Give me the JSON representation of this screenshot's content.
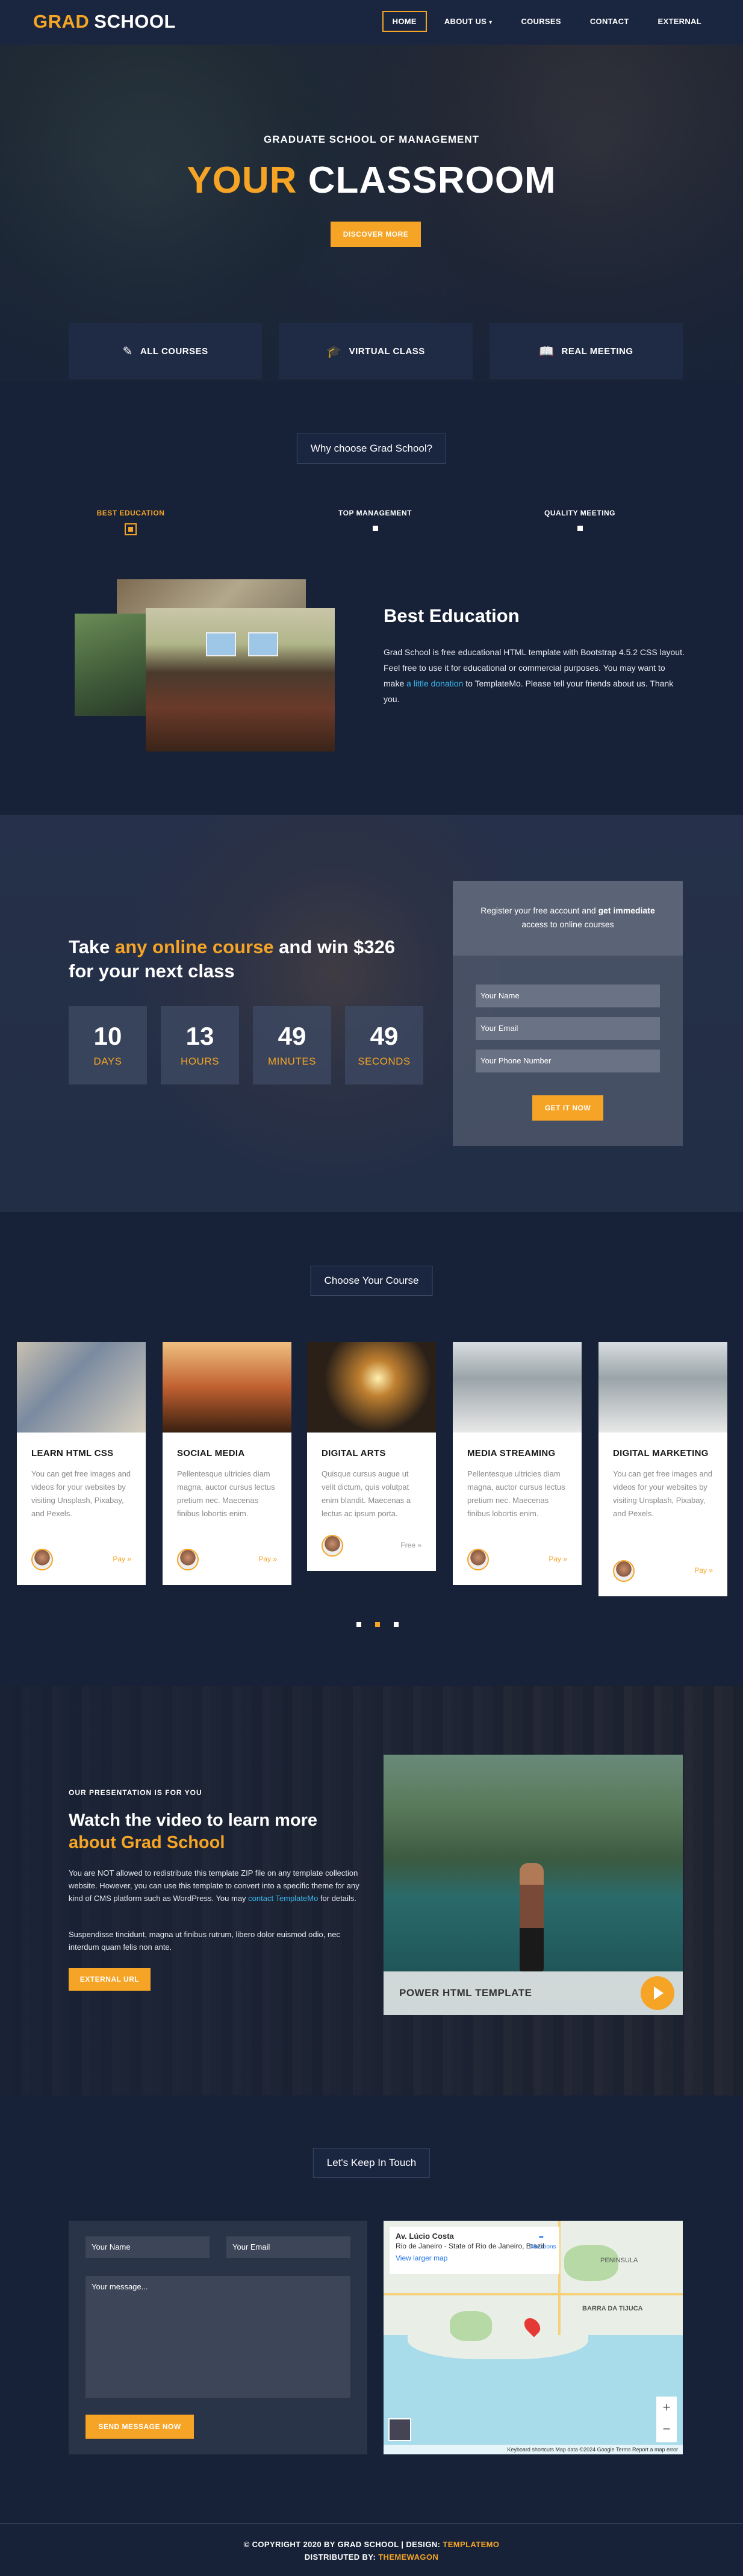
{
  "header": {
    "logo_part1": "GRAD",
    "logo_part2": "SCHOOL",
    "nav": [
      "HOME",
      "ABOUT US",
      "COURSES",
      "CONTACT",
      "EXTERNAL"
    ]
  },
  "hero": {
    "subtitle": "GRADUATE SCHOOL OF MANAGEMENT",
    "title_part1": "YOUR",
    "title_part2": "CLASSROOM",
    "button": "DISCOVER MORE",
    "features": [
      "ALL COURSES",
      "VIRTUAL CLASS",
      "REAL MEETING"
    ]
  },
  "why": {
    "title": "Why choose Grad School?",
    "tabs": [
      "BEST EDUCATION",
      "TOP MANAGEMENT",
      "QUALITY MEETING"
    ],
    "heading": "Best Education",
    "text_pre": "Grad School is free educational HTML template with Bootstrap 4.5.2 CSS layout. Feel free to use it for educational or commercial purposes. You may want to make ",
    "link": "a little donation",
    "text_post": " to TemplateMo. Please tell your friends about us. Thank you."
  },
  "countdown": {
    "title_pre": "Take ",
    "title_highlight": "any online course",
    "title_mid": " and win $326",
    "title_line2": "for your next class",
    "timer": [
      {
        "value": "10",
        "label": "DAYS"
      },
      {
        "value": "13",
        "label": "HOURS"
      },
      {
        "value": "49",
        "label": "MINUTES"
      },
      {
        "value": "49",
        "label": "SECONDS"
      }
    ],
    "register_line1_pre": "Register your free account and ",
    "register_line1_bold": "get immediate",
    "register_line2": "access to online courses",
    "name_placeholder": "Your Name",
    "email_placeholder": "Your Email",
    "phone_placeholder": "Your Phone Number",
    "button": "GET IT NOW"
  },
  "courses": {
    "title": "Choose Your Course",
    "cards": [
      {
        "title": "LEARN HTML CSS",
        "desc": "You can get free images and videos for your websites by visiting Unsplash, Pixabay, and Pexels.",
        "pay": "Pay »"
      },
      {
        "title": "SOCIAL MEDIA",
        "desc": "Pellentesque ultricies diam magna, auctor cursus lectus pretium nec. Maecenas finibus lobortis enim.",
        "pay": "Pay »"
      },
      {
        "title": "DIGITAL ARTS",
        "desc": "Quisque cursus augue ut velit dictum, quis volutpat enim blandit. Maecenas a lectus ac ipsum porta.",
        "pay": "Free »"
      },
      {
        "title": "MEDIA STREAMING",
        "desc": "Pellentesque ultricies diam magna, auctor cursus lectus pretium nec. Maecenas finibus lobortis enim.",
        "pay": "Pay »"
      },
      {
        "title": "DIGITAL MARKETING",
        "desc": "You can get free images and videos for your websites by visiting Unsplash, Pixabay, and Pexels.",
        "pay": "Pay »"
      }
    ]
  },
  "video": {
    "kicker": "OUR PRESENTATION IS FOR YOU",
    "title_line1": "Watch the video to learn more",
    "title_line2": "about Grad School",
    "p1_pre": "You are NOT allowed to redistribute this template ZIP file on any template collection website. However, you can use this template to convert into a specific theme for any kind of CMS platform such as WordPress. You may ",
    "p1_link1": "contact",
    "p1_link2": "TemplateMo",
    "p1_post": " for details.",
    "p2": "Suspendisse tincidunt, magna ut finibus rutrum, libero dolor euismod odio, nec interdum quam felis non ante.",
    "button": "EXTERNAL URL",
    "panel_title": "POWER HTML TEMPLATE"
  },
  "contact": {
    "title": "Let's Keep In Touch",
    "name_placeholder": "Your Name",
    "email_placeholder": "Your Email",
    "message_placeholder": "Your message...",
    "button": "SEND MESSAGE NOW",
    "map": {
      "place": "Av. Lúcio Costa",
      "address": "Rio de Janeiro - State of Rio de Janeiro, Brazil",
      "view_larger": "View larger map",
      "directions": "Directions",
      "labels": [
        "BARRA DA TIJUCA",
        "PENINSULA"
      ],
      "footer": "Keyboard shortcuts   Map data ©2024 Google   Terms   Report a map error"
    }
  },
  "footer": {
    "line1_pre": "© COPYRIGHT 2020 BY GRAD SCHOOL | DESIGN: ",
    "line1_link": "TEMPLATEMO",
    "line2_pre": "DISTRIBUTED BY: ",
    "line2_link": "THEMEWAGON"
  }
}
